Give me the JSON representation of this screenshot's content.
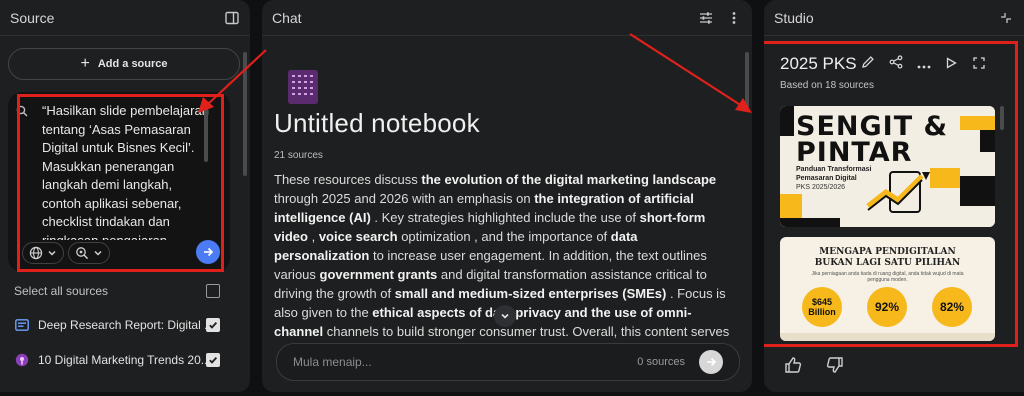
{
  "source_panel": {
    "title": "Source",
    "add_source_label": "Add a source",
    "query_text": "“Hasilkan slide pembelajaran tentang ‘Asas Pemasaran Digital untuk Bisnes Kecil’. Masukkan penerangan langkah demi langkah, contoh aplikasi sebenar, checklist tindakan dan ringkasan pengajaran",
    "select_all_label": "Select all sources",
    "sources": [
      {
        "title": "Deep Research Report: Digital ...",
        "icon": "document-icon",
        "checked": true
      },
      {
        "title": "10 Digital Marketing Trends 20...",
        "icon": "podcast-icon",
        "checked": true
      }
    ]
  },
  "chat_panel": {
    "title": "Chat",
    "notebook_title": "Untitled notebook",
    "source_count": "21 sources",
    "summary": [
      {
        "t": "These resources discuss ",
        "b": false
      },
      {
        "t": "the evolution of the digital marketing landscape",
        "b": true
      },
      {
        "t": " through 2025 and 2026 with an emphasis on ",
        "b": false
      },
      {
        "t": "the integration of artificial intelligence (AI)",
        "b": true
      },
      {
        "t": " . Key strategies highlighted include the use of ",
        "b": false
      },
      {
        "t": "short-form video",
        "b": true
      },
      {
        "t": " , ",
        "b": false
      },
      {
        "t": "voice search",
        "b": true
      },
      {
        "t": " optimization , and the importance of ",
        "b": false
      },
      {
        "t": "data personalization",
        "b": true
      },
      {
        "t": " to increase user engagement. In addition, the text outlines various ",
        "b": false
      },
      {
        "t": "government grants",
        "b": true
      },
      {
        "t": " and digital transformation assistance critical to driving the growth of ",
        "b": false
      },
      {
        "t": "small and medium-sized enterprises (SMEs)",
        "b": true
      },
      {
        "t": " . Focus is also given to the ",
        "b": false
      },
      {
        "t": "ethical aspects of data privacy and the use of omni-channel",
        "b": true
      },
      {
        "t": " channels to build stronger consumer trust. Overall, this content serves as a strategic guide for businesses to understand consumer trends and the future of marketing.",
        "b": false
      }
    ],
    "input_placeholder": "Mula menaip...",
    "input_sources": "0 sources"
  },
  "studio_panel": {
    "title": "Studio",
    "deck_title": "2025 PKS",
    "based_on": "Based on 18 sources",
    "slide1": {
      "heading_line1": "SENGIT &",
      "heading_line2": "PINTAR",
      "subtitle": "Panduan Transformasi Pemasaran Digital",
      "tag": "PKS 2025/2026"
    },
    "slide2": {
      "heading_line1": "MENGAPA PENDIGITALAN",
      "heading_line2": "BUKAN LAGI SATU PILIHAN",
      "caption": "Jika perniagaan anda tiada di ruang digital, anda tidak wujud di mata pengguna moden.",
      "stats": [
        "$645 Billion",
        "92%",
        "82%"
      ]
    }
  },
  "colors": {
    "accent_blue": "#4c7cf3",
    "annotation_red": "#e0201a",
    "slide_yellow": "#f6b81a"
  }
}
